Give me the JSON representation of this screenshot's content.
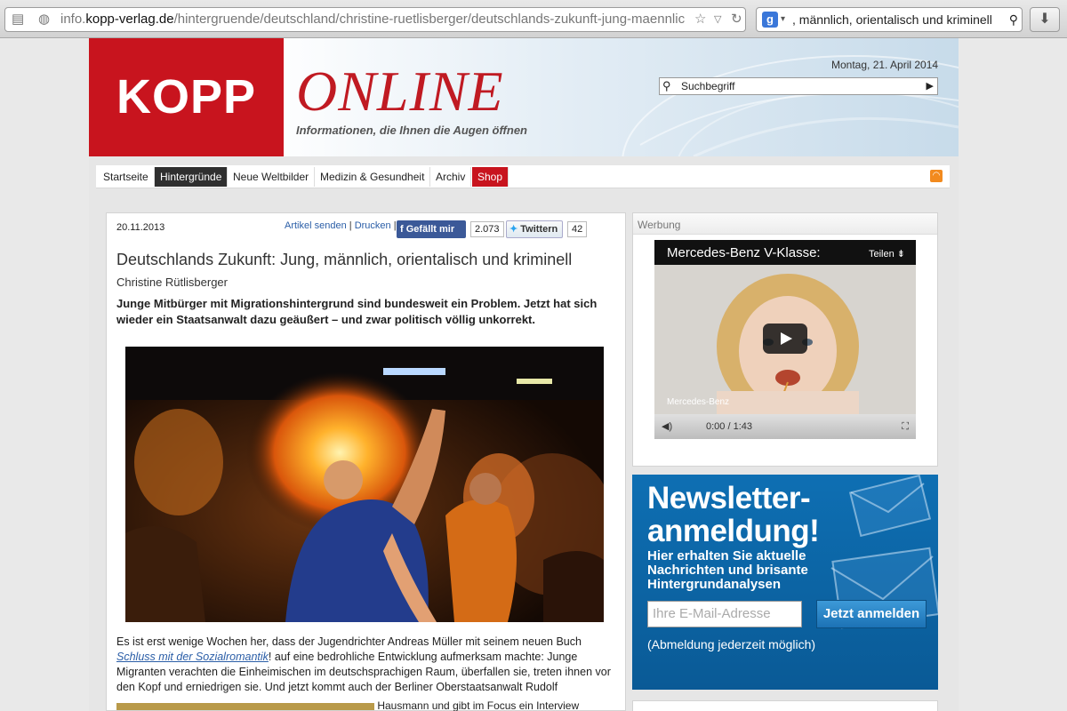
{
  "browser": {
    "url_prefix": "info.",
    "url_domain": "kopp-verlag.de",
    "url_path": "/hintergruende/deutschland/christine-ruetlisberger/deutschlands-zukunft-jung-maennlic",
    "search_text": ", männlich, orientalisch und kriminell"
  },
  "header": {
    "logo": "KOPP",
    "brand": "ONLINE",
    "tagline": "Informationen, die Ihnen die Augen öffnen",
    "date": "Montag, 21. April 2014",
    "search_placeholder": "Suchbegriff"
  },
  "nav": {
    "items": [
      {
        "label": "Startseite"
      },
      {
        "label": "Hintergründe"
      },
      {
        "label": "Neue Weltbilder"
      },
      {
        "label": "Medizin & Gesundheit"
      },
      {
        "label": "Archiv"
      },
      {
        "label": "Shop"
      }
    ]
  },
  "article": {
    "date": "20.11.2013",
    "send_link": "Artikel senden",
    "print_link": "Drucken",
    "like_label": "Gefällt mir",
    "like_count": "2.073",
    "tweet_label": "Twittern",
    "tweet_count": "42",
    "headline": "Deutschlands Zukunft: Jung, männlich, orientalisch und kriminell",
    "author": "Christine Rütlisberger",
    "lede": "Junge Mitbürger mit Migrationshintergrund sind bundesweit ein Problem. Jetzt hat sich wieder ein Staatsanwalt dazu geäußert – und zwar politisch völlig unkorrekt.",
    "body_start": "Es ist erst wenige Wochen her, dass der Jugendrichter Andreas Müller mit seinem neuen Buch ",
    "book_link": "Schluss mit der Sozialromantik",
    "body_rest": "! auf eine bedrohliche Entwicklung aufmerksam machte: Junge Migranten verachten die Einheimischen im deutschsprachigen Raum, überfallen sie, treten ihnen vor den Kopf und erniedrigen sie. Und jetzt kommt auch der Berliner Oberstaatsanwalt Rudolf",
    "body_more": "Hausmann und gibt im Focus ein Interview"
  },
  "ad": {
    "label": "Werbung",
    "video_title": "Mercedes-Benz V-Klasse:",
    "share": "Teilen",
    "brand": "Mercedes-Benz",
    "time": "0:00 / 1:43"
  },
  "newsletter": {
    "title_line1": "Newsletter-",
    "title_line2": "anmeldung!",
    "subtitle": "Hier erhalten Sie aktuelle Nachrichten und brisante Hintergrundanalysen",
    "email_placeholder": "Ihre E-Mail-Adresse",
    "button": "Jetzt anmelden",
    "note": "(Abmeldung jederzeit möglich)"
  }
}
